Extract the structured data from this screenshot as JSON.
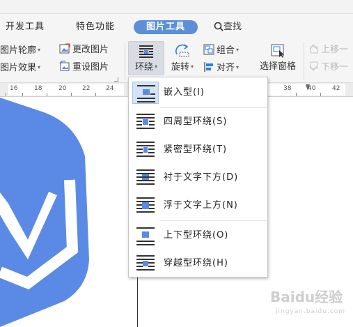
{
  "tabs": {
    "developer": "开发工具",
    "special": "特色功能",
    "picture_tools": "图片工具",
    "search": "查找"
  },
  "ribbon": {
    "outline": "图片轮廓",
    "effects": "图片效果",
    "change_picture": "更改图片",
    "reset_picture": "重设图片",
    "wrap": "环绕",
    "rotate": "旋转",
    "group": "组合",
    "align": "对齐",
    "selection_pane": "选择窗格",
    "bring_forward": "上移一",
    "send_backward": "下移一"
  },
  "ruler": {
    "labels": [
      "16",
      "18",
      "20",
      "22",
      "24",
      "38",
      "40",
      "42"
    ]
  },
  "wrap_menu": {
    "items": [
      {
        "label": "嵌入型(I)",
        "selected": true
      },
      {
        "label": "四周型环绕(S)",
        "selected": false
      },
      {
        "label": "紧密型环绕(T)",
        "selected": false
      },
      {
        "label": "衬于文字下方(D)",
        "selected": false
      },
      {
        "label": "浮于文字上方(N)",
        "selected": false
      },
      {
        "label": "上下型环绕(O)",
        "selected": false
      },
      {
        "label": "穿越型环绕(H)",
        "selected": false
      }
    ]
  },
  "watermark": {
    "text": "Baidu经验",
    "sub": "jingyan.baidu.com"
  },
  "colors": {
    "accent": "#5b8fd8",
    "shape_fill": "#5b8ae6",
    "menu_highlight": "#d4e3f5"
  }
}
